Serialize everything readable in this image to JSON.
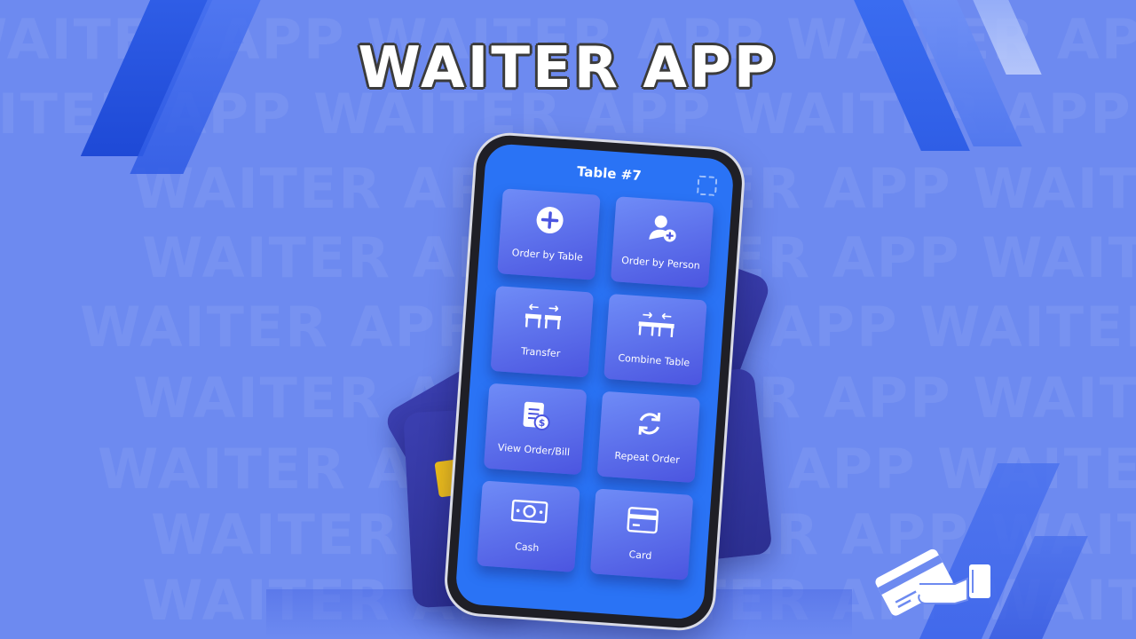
{
  "banner": {
    "title": "WAITER APP",
    "watermark": "WAITER APP WAITER APP WAITER APP WAITER APP WAITER APP"
  },
  "phone": {
    "screen_title": "Table #7",
    "tiles": [
      {
        "label": "Order by Table",
        "icon": "plus-circle-icon"
      },
      {
        "label": "Order by Person",
        "icon": "add-person-icon"
      },
      {
        "label": "Transfer",
        "icon": "transfer-tables-icon"
      },
      {
        "label": "Combine Table",
        "icon": "combine-tables-icon"
      },
      {
        "label": "View Order/Bill",
        "icon": "bill-icon"
      },
      {
        "label": "Repeat Order",
        "icon": "refresh-icon"
      },
      {
        "label": "Cash",
        "icon": "cash-icon"
      },
      {
        "label": "Card",
        "icon": "credit-card-icon"
      }
    ]
  },
  "colors": {
    "background": "#6d8af0",
    "screen": "#2a73f5",
    "tile_top": "#6f8cf7",
    "tile_bottom": "#4b55e0",
    "card": "#2f3399",
    "chip": "#f3c21a"
  }
}
